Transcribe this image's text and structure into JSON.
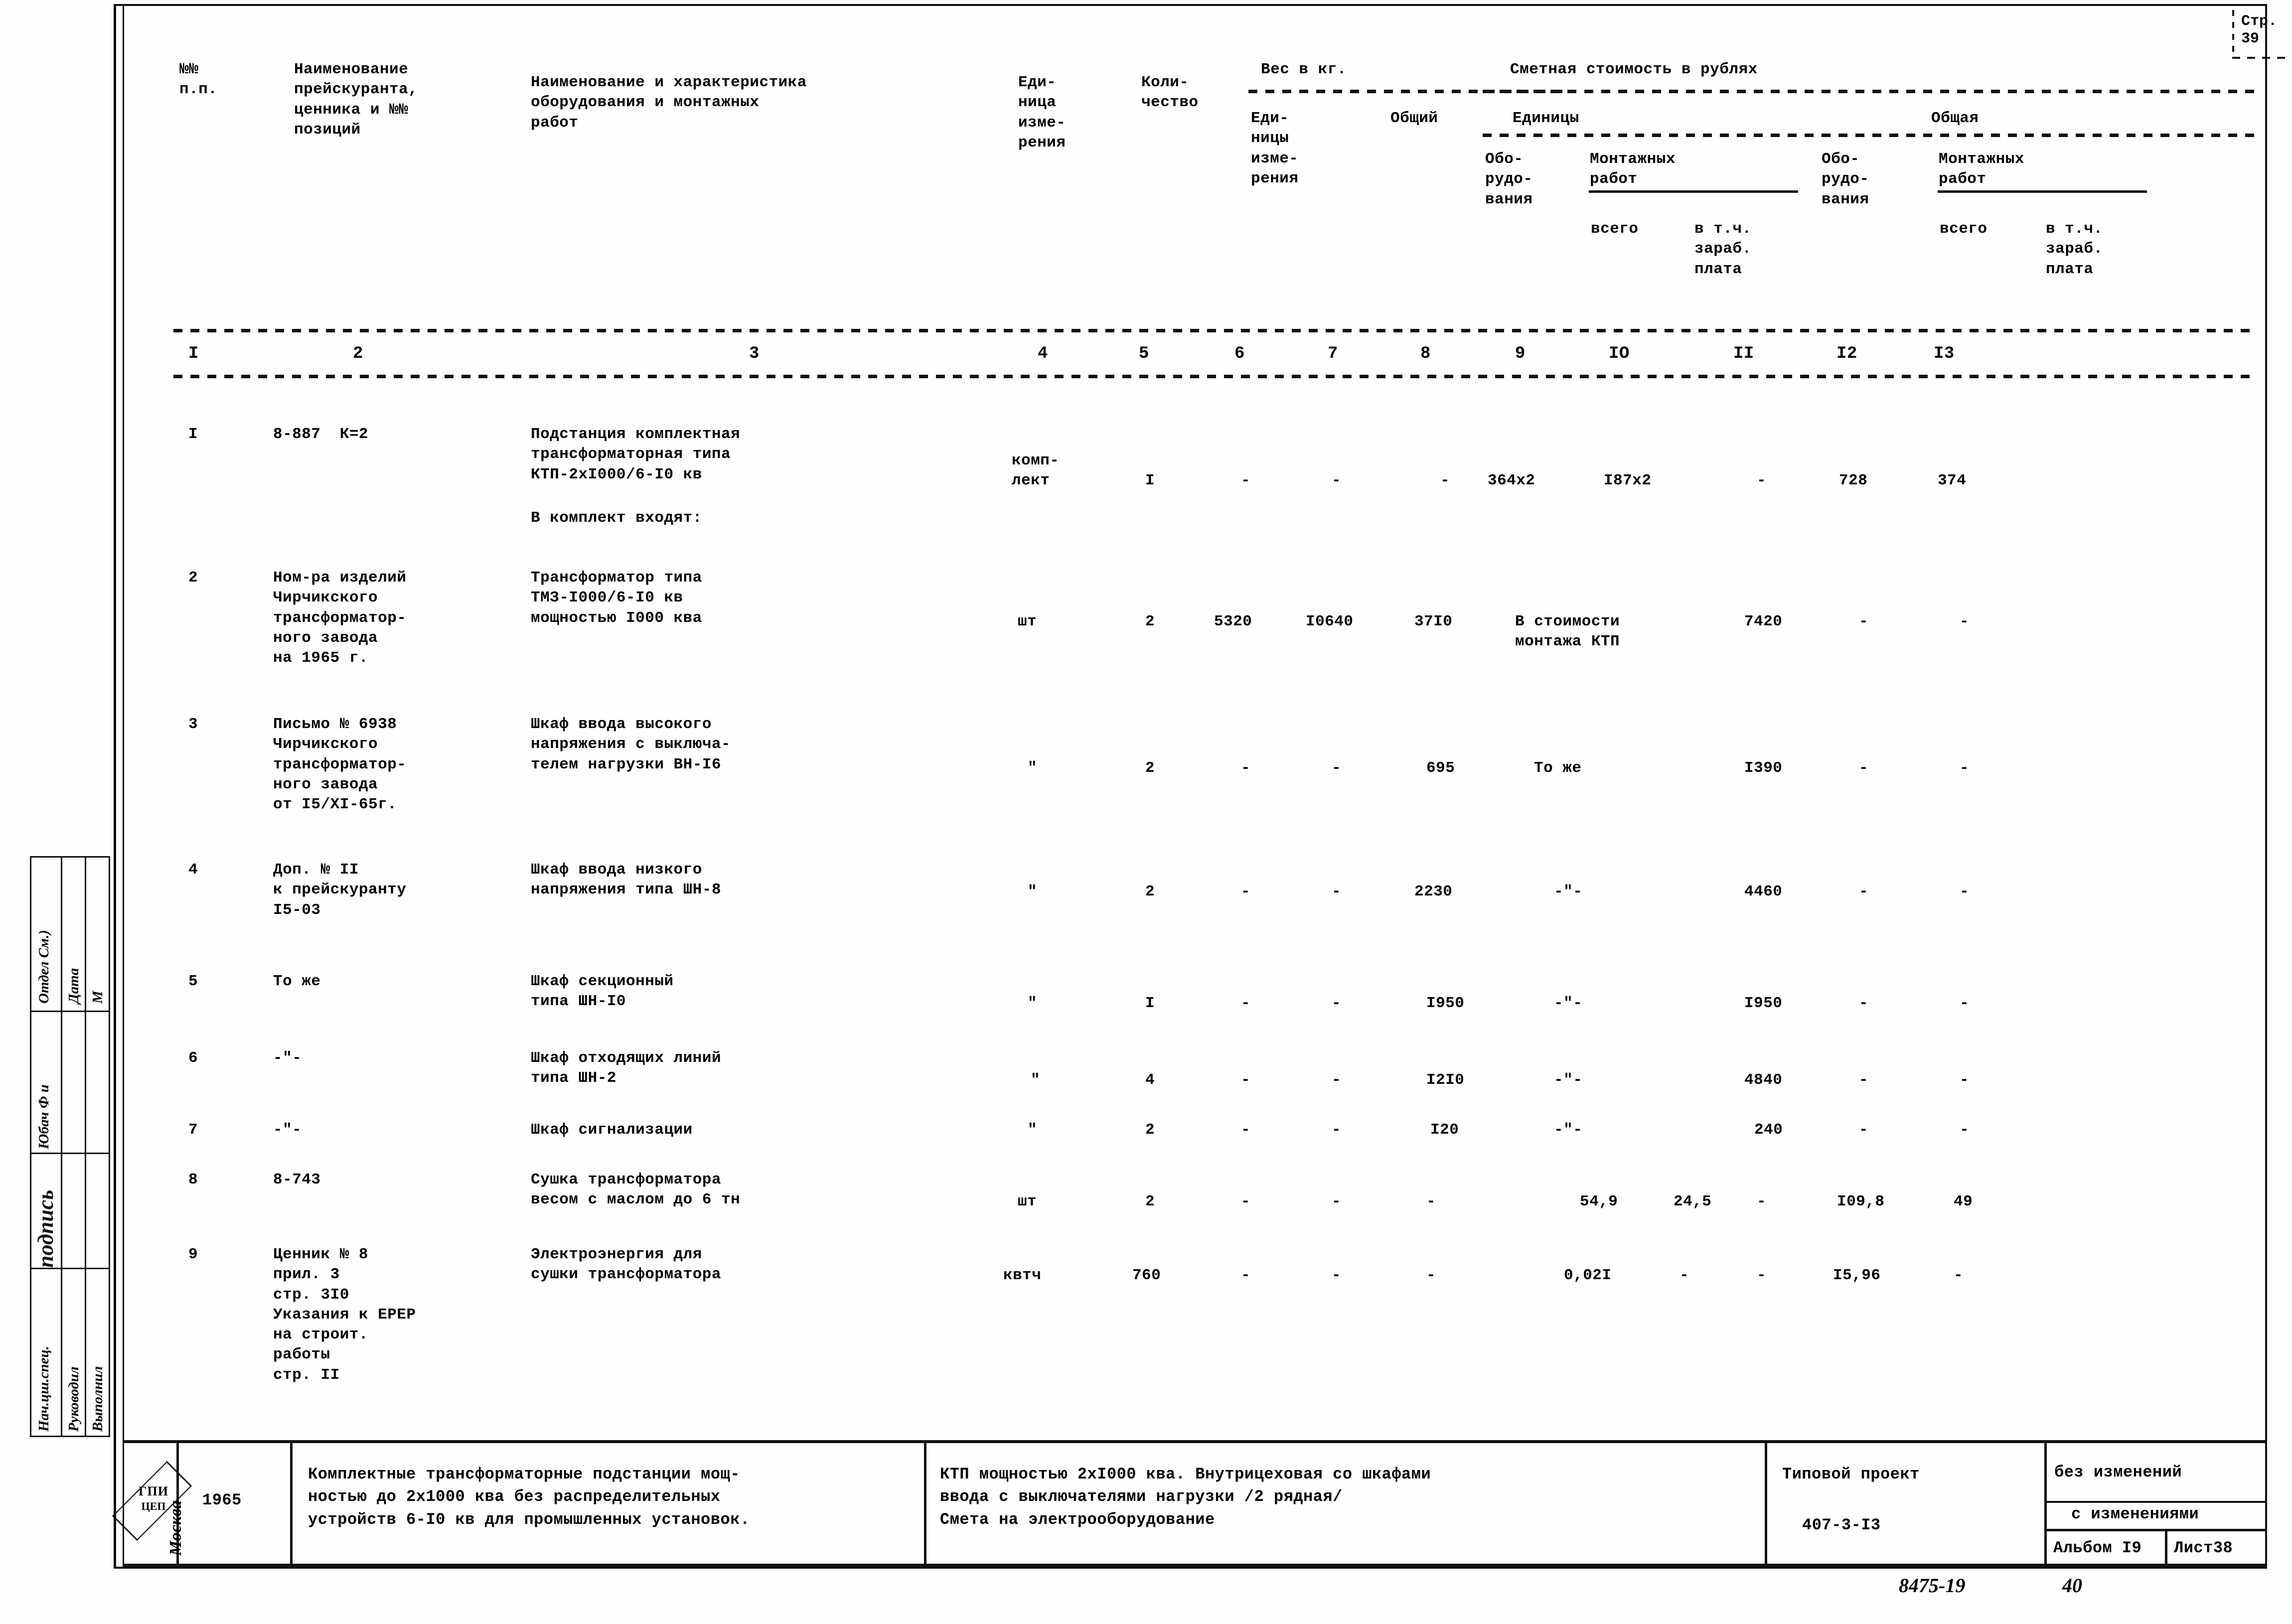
{
  "page": {
    "page_label_line1": "Стр.",
    "page_label_line2": "39"
  },
  "table": {
    "headers": {
      "col1": "№№\nп.п.",
      "col2": "Наименование\nпрейскуранта,\nценника и №№\nпозиций",
      "col3": "Наименование и характеристика\nоборудования и монтажных\nработ",
      "col4": "Еди-\nница\nизме-\nрения",
      "col5": "Коли-\nчество",
      "weight_group": "Вес в кг.",
      "col6": "Еди-\nницы\nизме-\nрения",
      "col7": "Общий",
      "cost_group": "Сметная стоимость в рублях",
      "unit_group": "Единицы",
      "total_group": "Общая",
      "col8": "Обо-\nрудо-\nвания",
      "montazh_unit": "Монтажных\nработ",
      "col9": "всего",
      "col10": "в т.ч.\nзараб.\nплата",
      "col11": "Обо-\nрудо-\nвания",
      "montazh_total": "Монтажных\nработ",
      "col12": "всего",
      "col13": "в т.ч.\nзараб.\nплата"
    },
    "column_numbers": [
      "I",
      "2",
      "3",
      "4",
      "5",
      "6",
      "7",
      "8",
      "9",
      "IO",
      "II",
      "I2",
      "I3"
    ],
    "rows": [
      {
        "n": "I",
        "source": "8-887  К=2",
        "name": "Подстанция комплектная\nтрансформаторная типа\nКТП-2хI000/6-I0 кв",
        "note": "В комплект входят:",
        "unit": "комп-\nлект",
        "qty": "I",
        "w_unit": "-",
        "w_total": "-",
        "c_equip": "-",
        "c_mont_all": "364х2",
        "c_mont_wage": "I87х2",
        "t_equip": "-",
        "t_mont_all": "728",
        "t_mont_wage": "374"
      },
      {
        "n": "2",
        "source": "Ном-ра изделий\nЧирчикского\nтрансформатор-\nного завода\nна 1965 г.",
        "name": "Трансформатор типа\nТМЗ-I000/6-I0 кв\nмощностью I000 ква",
        "note": "",
        "unit": "шт",
        "qty": "2",
        "w_unit": "5320",
        "w_total": "I0640",
        "c_equip": "37I0",
        "c_mont_span": "В стоимости\nмонтажа КТП",
        "t_equip": "7420",
        "t_mont_all": "-",
        "t_mont_wage": "-"
      },
      {
        "n": "3",
        "source": "Письмо № 6938\nЧирчикского\nтрансформатор-\nного завода\nот I5/XI-65г.",
        "name": "Шкаф ввода высокого\nнапряжения с выключа-\nтелем нагрузки ВН-I6",
        "note": "",
        "unit": "\"",
        "qty": "2",
        "w_unit": "-",
        "w_total": "-",
        "c_equip": "695",
        "c_mont_span": "То же",
        "t_equip": "I390",
        "t_mont_all": "-",
        "t_mont_wage": "-"
      },
      {
        "n": "4",
        "source": "Доп. № II\nк прейскуранту\nI5-03",
        "name": "Шкаф ввода низкого\nнапряжения типа ШН-8",
        "note": "",
        "unit": "\"",
        "qty": "2",
        "w_unit": "-",
        "w_total": "-",
        "c_equip": "2230",
        "c_mont_span": "-\"-",
        "t_equip": "4460",
        "t_mont_all": "-",
        "t_mont_wage": "-"
      },
      {
        "n": "5",
        "source": "То же",
        "name": "Шкаф секционный\nтипа ШН-I0",
        "note": "",
        "unit": "\"",
        "qty": "I",
        "w_unit": "-",
        "w_total": "-",
        "c_equip": "I950",
        "c_mont_span": "-\"-",
        "t_equip": "I950",
        "t_mont_all": "-",
        "t_mont_wage": "-"
      },
      {
        "n": "6",
        "source": "-\"-",
        "name": "Шкаф отходящих линий\nтипа ШН-2",
        "note": "",
        "unit": "\"",
        "qty": "4",
        "w_unit": "-",
        "w_total": "-",
        "c_equip": "I2I0",
        "c_mont_span": "-\"-",
        "t_equip": "4840",
        "t_mont_all": "-",
        "t_mont_wage": "-"
      },
      {
        "n": "7",
        "source": "-\"-",
        "name": "Шкаф сигнализации",
        "note": "",
        "unit": "\"",
        "qty": "2",
        "w_unit": "-",
        "w_total": "-",
        "c_equip": "I20",
        "c_mont_span": "-\"-",
        "t_equip": "240",
        "t_mont_all": "-",
        "t_mont_wage": "-"
      },
      {
        "n": "8",
        "source": "8-743",
        "name": "Сушка трансформатора\nвесом с маслом до 6 тн",
        "note": "",
        "unit": "шт",
        "qty": "2",
        "w_unit": "-",
        "w_total": "-",
        "c_equip": "-",
        "c_mont_all": "54,9",
        "c_mont_wage": "24,5",
        "t_equip": "-",
        "t_mont_all": "I09,8",
        "t_mont_wage": "49"
      },
      {
        "n": "9",
        "source": "Ценник № 8\nприл. 3\nстр. 3I0\nУказания к ЕРЕР\nна строит.\nработы\nстр. II",
        "name": "Электроэнергия для\nсушки трансформатора",
        "note": "",
        "unit": "квтч",
        "qty": "760",
        "w_unit": "-",
        "w_total": "-",
        "c_equip": "-",
        "c_mont_all": "0,02I",
        "c_mont_wage": "-",
        "t_equip": "-",
        "t_mont_all": "I5,96",
        "t_mont_wage": "-"
      }
    ]
  },
  "stamp_column": {
    "row1": "Отдел См.)",
    "row1b": "Юбач Ф и",
    "row2": "Нач.цш.спец.",
    "row3": "Руководил",
    "row4": "Выполнил",
    "date": "Дата",
    "m": "М",
    "signature": "подпись"
  },
  "title_block": {
    "logo_line1": "ГПИ",
    "logo_line2": "ЦЕП",
    "city": "Москва",
    "year": "1965",
    "object": "Комплектные трансформаторные подстанции мощ-\nностью до 2х1000 ква без распределительных\nустройств 6-I0 кв для промышленных установок.",
    "description": "КТП мощностью 2хI000 ква. Внутрицеховая со шкафами\nввода с выключателями нагрузки /2 рядная/\nСмета на электрооборудование",
    "project_label": "Типовой проект",
    "project_code": "407-3-I3",
    "rev_none": "без изменений",
    "rev_with": "с изменениями",
    "album": "Альбом I9",
    "sheet": "Лист38",
    "hand_code": "8475-19",
    "hand_num": "40"
  }
}
